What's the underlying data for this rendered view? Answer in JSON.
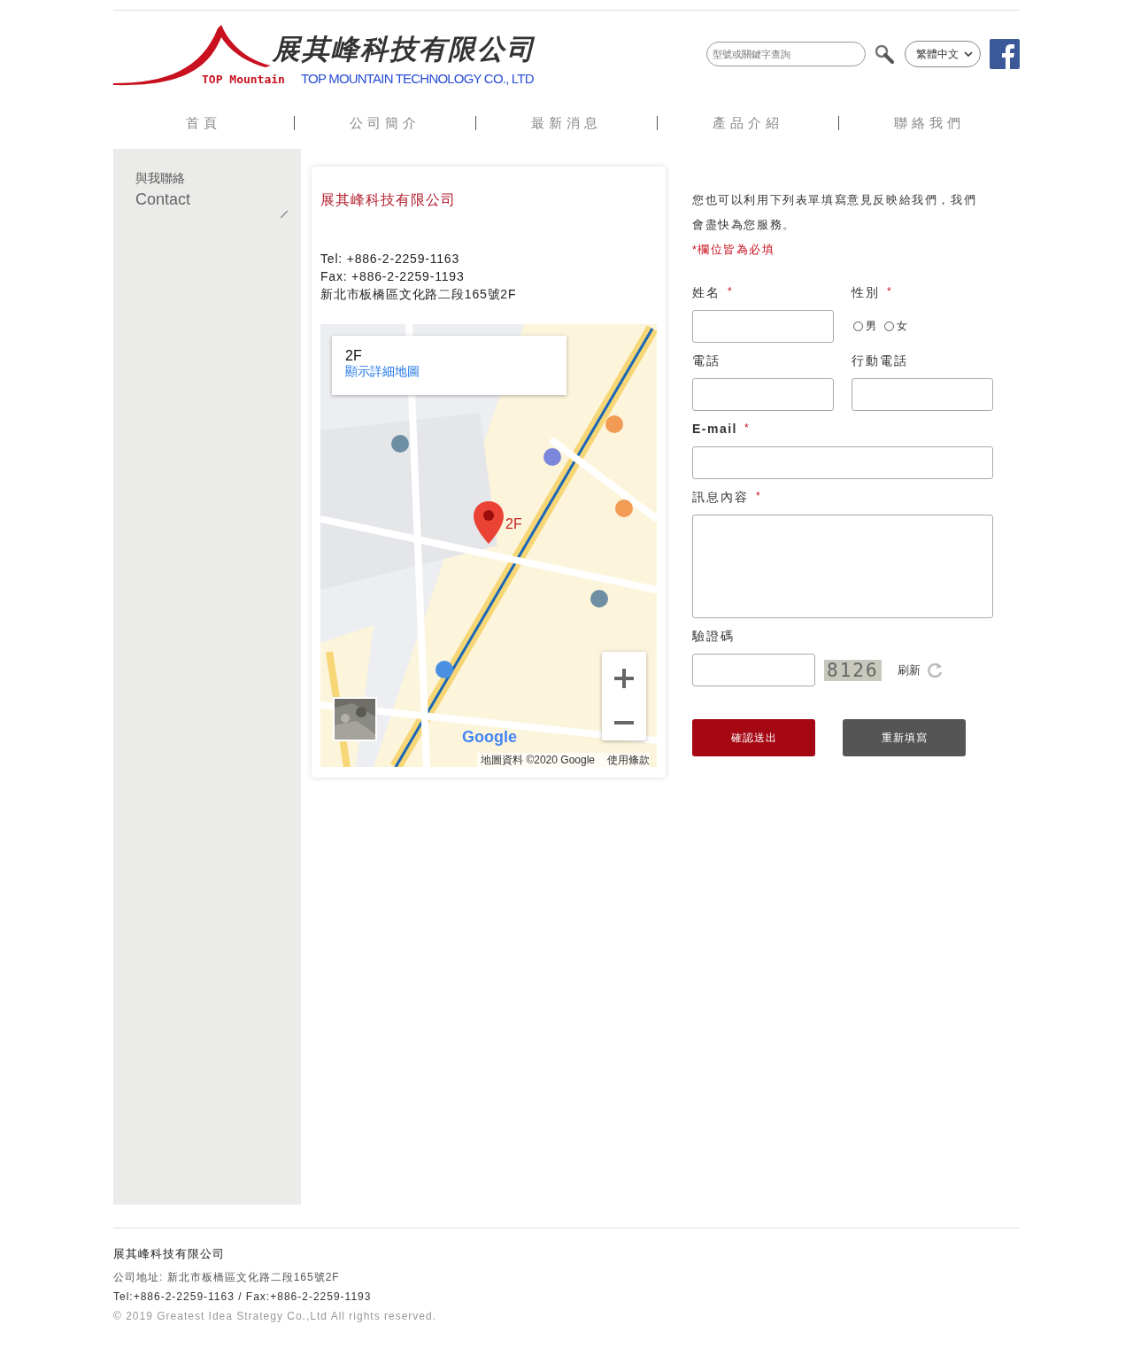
{
  "header": {
    "company_name": "展其峰科技有限公司",
    "logo_tagline": "TOP Mountain",
    "english_name": "TOP MOUNTAIN TECHNOLOGY CO., LTD",
    "search": {
      "placeholder": "型號或關鍵字查詢"
    },
    "language": "繁體中文"
  },
  "nav": [
    {
      "label": "首頁"
    },
    {
      "label": "公司簡介"
    },
    {
      "label": "最新消息"
    },
    {
      "label": "產品介紹"
    },
    {
      "label": "聯絡我們"
    }
  ],
  "sidebar": {
    "title": "與我聯絡",
    "subtitle": "Contact"
  },
  "contact_card": {
    "company": "展其峰科技有限公司",
    "lines": [
      "Tel: +886-2-2259-1163",
      "Fax: +886-2-2259-1193",
      "新北市板橋區文化路二段165號2F"
    ],
    "map": {
      "info_title": "2F",
      "info_link": "顯示詳細地圖",
      "marker_label": "2F",
      "logo": "Google",
      "attribution": "地圖資料 ©2020 Google",
      "terms": "使用條款"
    }
  },
  "form": {
    "intro": "您也可以利用下列表單填寫意見反映給我們，我們會盡快為您服務。",
    "required_note": "*欄位皆為必填",
    "required_mark": "*",
    "fields": [
      {
        "kind": "text",
        "label": "姓名",
        "required": true
      },
      {
        "kind": "radio",
        "label": "性別",
        "required": true,
        "options": [
          {
            "label": "男",
            "selected": false
          },
          {
            "label": "女",
            "selected": false
          }
        ]
      },
      {
        "kind": "text",
        "label": "電話",
        "required": false
      },
      {
        "kind": "text",
        "label": "行動電話",
        "required": false
      },
      {
        "kind": "wide",
        "label": "E-mail",
        "required": true
      },
      {
        "kind": "textarea",
        "label": "訊息內容",
        "required": true
      },
      {
        "kind": "captcha",
        "label": "驗證碼",
        "required": false,
        "code": "8126",
        "refresh": "刷新"
      }
    ],
    "buttons": [
      {
        "label": "確認送出",
        "kind": "primary"
      },
      {
        "label": "重新填寫",
        "kind": "secondary"
      }
    ]
  },
  "footer": {
    "company": "展其峰科技有限公司",
    "address": "公司地址: 新北市板橋區文化路二段165號2F",
    "phone": "Tel:+886-2-2259-1163 / Fax:+886-2-2259-1193",
    "copyright": "© 2019 Greatest Idea Strategy Co.,Ltd All rights reserved."
  }
}
